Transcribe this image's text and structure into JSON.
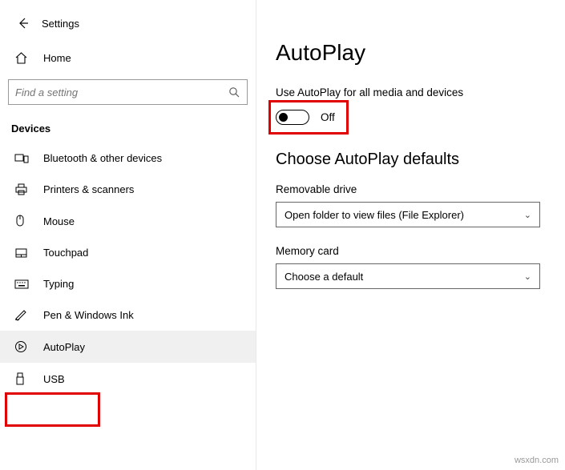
{
  "header": {
    "title": "Settings"
  },
  "home": {
    "label": "Home"
  },
  "search": {
    "placeholder": "Find a setting"
  },
  "section": {
    "title": "Devices"
  },
  "nav": {
    "items": [
      {
        "label": "Bluetooth & other devices"
      },
      {
        "label": "Printers & scanners"
      },
      {
        "label": "Mouse"
      },
      {
        "label": "Touchpad"
      },
      {
        "label": "Typing"
      },
      {
        "label": "Pen & Windows Ink"
      },
      {
        "label": "AutoPlay"
      },
      {
        "label": "USB"
      }
    ]
  },
  "page": {
    "title": "AutoPlay",
    "toggle_label": "Use AutoPlay for all media and devices",
    "toggle_state": "Off",
    "defaults_heading": "Choose AutoPlay defaults",
    "removable": {
      "label": "Removable drive",
      "value": "Open folder to view files (File Explorer)"
    },
    "memory": {
      "label": "Memory card",
      "value": "Choose a default"
    }
  },
  "watermark": "wsxdn.com"
}
